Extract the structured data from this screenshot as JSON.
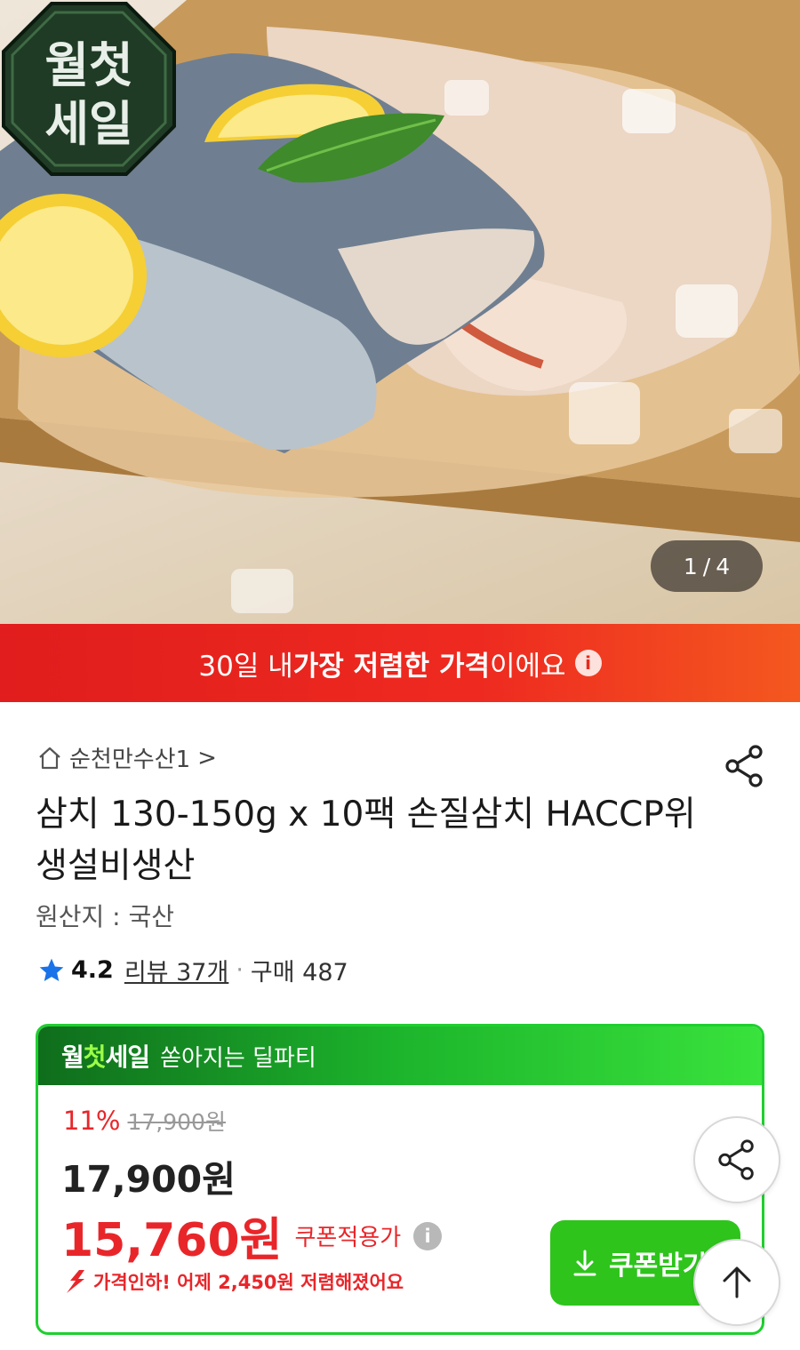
{
  "hero": {
    "badge_line1": "월첫",
    "badge_line2": "세일",
    "page_current": "1",
    "page_separator": "/",
    "page_total": "4"
  },
  "price_banner": {
    "prefix": "30일 내 ",
    "highlight": "가장 저렴한 가격",
    "suffix": "이에요",
    "info_glyph": "i",
    "bg_start": "#e11d1d",
    "bg_end": "#f4581f"
  },
  "product": {
    "seller_name": "순천만수산1",
    "seller_chevron": ">",
    "title": "삼치 130-150g x 10팩 손질삼치 HACCP위생설비생산",
    "origin": "원산지 : 국산",
    "rating": "4.2",
    "reviews": "리뷰 37개",
    "separator": "·",
    "purchases": "구매 487"
  },
  "sale": {
    "logo_part1": "월",
    "logo_part2": "첫",
    "logo_part3": "세일",
    "tagline": "쏟아지는 딜파티",
    "discount_percent": "11%",
    "original_price": "17,900원",
    "base_price": "17,900원",
    "coupon_price": "15,760원",
    "coupon_price_label": "쿠폰적용가",
    "info_glyph": "i",
    "price_drop_text": "가격인하! 어제 2,450원 저렴해졌어요",
    "coupon_button_label": "쿠폰받기",
    "accent_green": "#2ec41c",
    "accent_red": "#e8262a"
  },
  "icons": {
    "home": "home-icon",
    "share": "share-icon",
    "star": "star-icon",
    "download": "download-icon",
    "arrow_up": "arrow-up-icon",
    "price_drop": "price-drop-arrow-icon"
  }
}
